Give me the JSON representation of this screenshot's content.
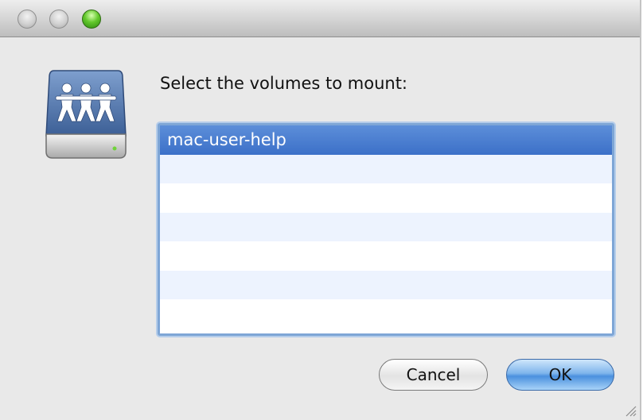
{
  "window": {
    "title_buttons": [
      "close-icon",
      "minimize-icon",
      "zoom-icon"
    ]
  },
  "dialog": {
    "icon": "network-share-icon",
    "prompt": "Select the volumes to mount:",
    "volumes": [
      {
        "label": "mac-user-help",
        "selected": true
      },
      {
        "label": ""
      },
      {
        "label": ""
      },
      {
        "label": ""
      },
      {
        "label": ""
      },
      {
        "label": ""
      },
      {
        "label": ""
      }
    ],
    "buttons": {
      "cancel": "Cancel",
      "ok": "OK"
    }
  },
  "colors": {
    "selection": "#4a7fd0",
    "alt_row": "#edf3fe",
    "list_focus_ring": "#7ea6d6"
  }
}
